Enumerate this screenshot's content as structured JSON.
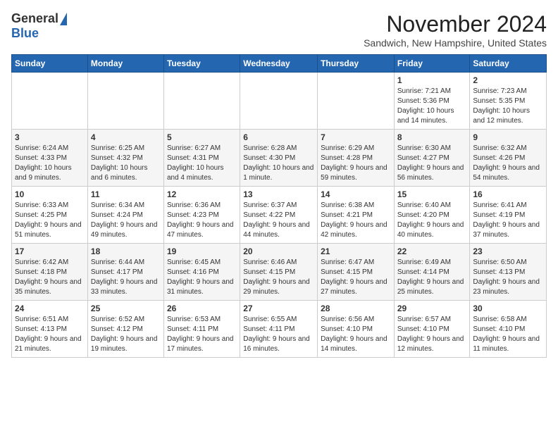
{
  "logo": {
    "general": "General",
    "blue": "Blue"
  },
  "header": {
    "month_title": "November 2024",
    "location": "Sandwich, New Hampshire, United States"
  },
  "weekdays": [
    "Sunday",
    "Monday",
    "Tuesday",
    "Wednesday",
    "Thursday",
    "Friday",
    "Saturday"
  ],
  "weeks": [
    [
      {
        "day": "",
        "info": ""
      },
      {
        "day": "",
        "info": ""
      },
      {
        "day": "",
        "info": ""
      },
      {
        "day": "",
        "info": ""
      },
      {
        "day": "",
        "info": ""
      },
      {
        "day": "1",
        "info": "Sunrise: 7:21 AM\nSunset: 5:36 PM\nDaylight: 10 hours and 14 minutes."
      },
      {
        "day": "2",
        "info": "Sunrise: 7:23 AM\nSunset: 5:35 PM\nDaylight: 10 hours and 12 minutes."
      }
    ],
    [
      {
        "day": "3",
        "info": "Sunrise: 6:24 AM\nSunset: 4:33 PM\nDaylight: 10 hours and 9 minutes."
      },
      {
        "day": "4",
        "info": "Sunrise: 6:25 AM\nSunset: 4:32 PM\nDaylight: 10 hours and 6 minutes."
      },
      {
        "day": "5",
        "info": "Sunrise: 6:27 AM\nSunset: 4:31 PM\nDaylight: 10 hours and 4 minutes."
      },
      {
        "day": "6",
        "info": "Sunrise: 6:28 AM\nSunset: 4:30 PM\nDaylight: 10 hours and 1 minute."
      },
      {
        "day": "7",
        "info": "Sunrise: 6:29 AM\nSunset: 4:28 PM\nDaylight: 9 hours and 59 minutes."
      },
      {
        "day": "8",
        "info": "Sunrise: 6:30 AM\nSunset: 4:27 PM\nDaylight: 9 hours and 56 minutes."
      },
      {
        "day": "9",
        "info": "Sunrise: 6:32 AM\nSunset: 4:26 PM\nDaylight: 9 hours and 54 minutes."
      }
    ],
    [
      {
        "day": "10",
        "info": "Sunrise: 6:33 AM\nSunset: 4:25 PM\nDaylight: 9 hours and 51 minutes."
      },
      {
        "day": "11",
        "info": "Sunrise: 6:34 AM\nSunset: 4:24 PM\nDaylight: 9 hours and 49 minutes."
      },
      {
        "day": "12",
        "info": "Sunrise: 6:36 AM\nSunset: 4:23 PM\nDaylight: 9 hours and 47 minutes."
      },
      {
        "day": "13",
        "info": "Sunrise: 6:37 AM\nSunset: 4:22 PM\nDaylight: 9 hours and 44 minutes."
      },
      {
        "day": "14",
        "info": "Sunrise: 6:38 AM\nSunset: 4:21 PM\nDaylight: 9 hours and 42 minutes."
      },
      {
        "day": "15",
        "info": "Sunrise: 6:40 AM\nSunset: 4:20 PM\nDaylight: 9 hours and 40 minutes."
      },
      {
        "day": "16",
        "info": "Sunrise: 6:41 AM\nSunset: 4:19 PM\nDaylight: 9 hours and 37 minutes."
      }
    ],
    [
      {
        "day": "17",
        "info": "Sunrise: 6:42 AM\nSunset: 4:18 PM\nDaylight: 9 hours and 35 minutes."
      },
      {
        "day": "18",
        "info": "Sunrise: 6:44 AM\nSunset: 4:17 PM\nDaylight: 9 hours and 33 minutes."
      },
      {
        "day": "19",
        "info": "Sunrise: 6:45 AM\nSunset: 4:16 PM\nDaylight: 9 hours and 31 minutes."
      },
      {
        "day": "20",
        "info": "Sunrise: 6:46 AM\nSunset: 4:15 PM\nDaylight: 9 hours and 29 minutes."
      },
      {
        "day": "21",
        "info": "Sunrise: 6:47 AM\nSunset: 4:15 PM\nDaylight: 9 hours and 27 minutes."
      },
      {
        "day": "22",
        "info": "Sunrise: 6:49 AM\nSunset: 4:14 PM\nDaylight: 9 hours and 25 minutes."
      },
      {
        "day": "23",
        "info": "Sunrise: 6:50 AM\nSunset: 4:13 PM\nDaylight: 9 hours and 23 minutes."
      }
    ],
    [
      {
        "day": "24",
        "info": "Sunrise: 6:51 AM\nSunset: 4:13 PM\nDaylight: 9 hours and 21 minutes."
      },
      {
        "day": "25",
        "info": "Sunrise: 6:52 AM\nSunset: 4:12 PM\nDaylight: 9 hours and 19 minutes."
      },
      {
        "day": "26",
        "info": "Sunrise: 6:53 AM\nSunset: 4:11 PM\nDaylight: 9 hours and 17 minutes."
      },
      {
        "day": "27",
        "info": "Sunrise: 6:55 AM\nSunset: 4:11 PM\nDaylight: 9 hours and 16 minutes."
      },
      {
        "day": "28",
        "info": "Sunrise: 6:56 AM\nSunset: 4:10 PM\nDaylight: 9 hours and 14 minutes."
      },
      {
        "day": "29",
        "info": "Sunrise: 6:57 AM\nSunset: 4:10 PM\nDaylight: 9 hours and 12 minutes."
      },
      {
        "day": "30",
        "info": "Sunrise: 6:58 AM\nSunset: 4:10 PM\nDaylight: 9 hours and 11 minutes."
      }
    ]
  ]
}
